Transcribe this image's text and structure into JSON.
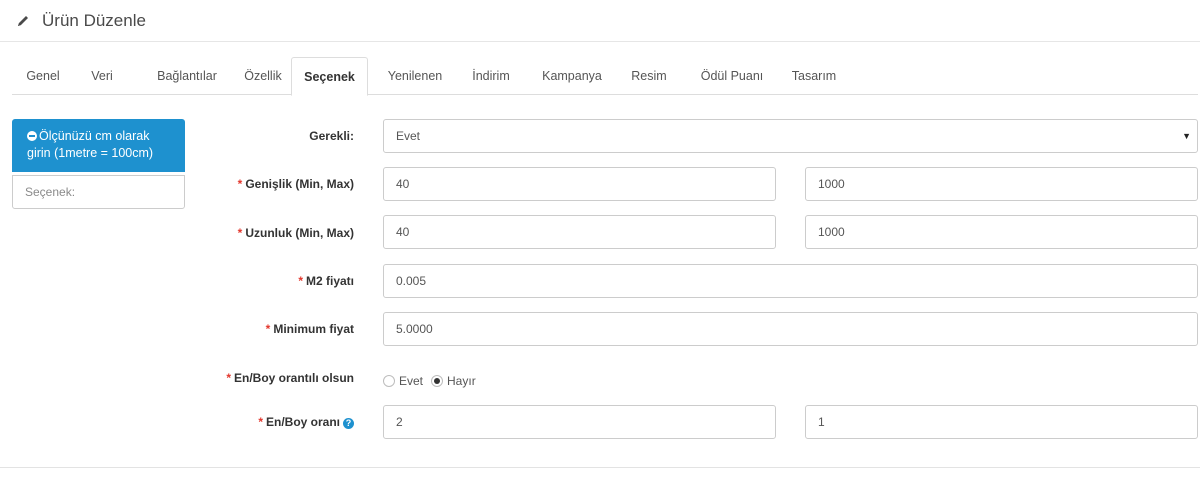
{
  "header": {
    "title": "Ürün Düzenle",
    "icon": "pencil-icon"
  },
  "tabs": [
    {
      "label": "Genel"
    },
    {
      "label": "Veri"
    },
    {
      "label": "Bağlantılar"
    },
    {
      "label": "Özellik"
    },
    {
      "label": "Seçenek",
      "active": true
    },
    {
      "label": "Yenilenen"
    },
    {
      "label": "İndirim"
    },
    {
      "label": "Kampanya"
    },
    {
      "label": "Resim"
    },
    {
      "label": "Ödül Puanı"
    },
    {
      "label": "Tasarım"
    }
  ],
  "sidebar": {
    "active_option": "Ölçünüzü cm olarak girin (1metre = 100cm)",
    "option_placeholder": "Seçenek:"
  },
  "form": {
    "required_mark": "*",
    "gerekli": {
      "label": "Gerekli:",
      "value": "Evet",
      "caret": "▼"
    },
    "genislik": {
      "label": "Genişlik (Min, Max)",
      "min": "40",
      "max": "1000"
    },
    "uzunluk": {
      "label": "Uzunluk (Min, Max)",
      "min": "40",
      "max": "1000"
    },
    "m2_fiyati": {
      "label": "M2 fiyatı",
      "value": "0.005"
    },
    "minimum_fiyat": {
      "label": "Minimum fiyat",
      "value": "5.0000"
    },
    "orantili": {
      "label": "En/Boy orantılı olsun",
      "option_yes": "Evet",
      "option_no": "Hayır",
      "selected": "Hayır"
    },
    "oran": {
      "label": "En/Boy oranı",
      "help": "?",
      "first": "2",
      "second": "1"
    }
  },
  "colors": {
    "accent": "#1e91cf",
    "required": "#e3372d"
  }
}
